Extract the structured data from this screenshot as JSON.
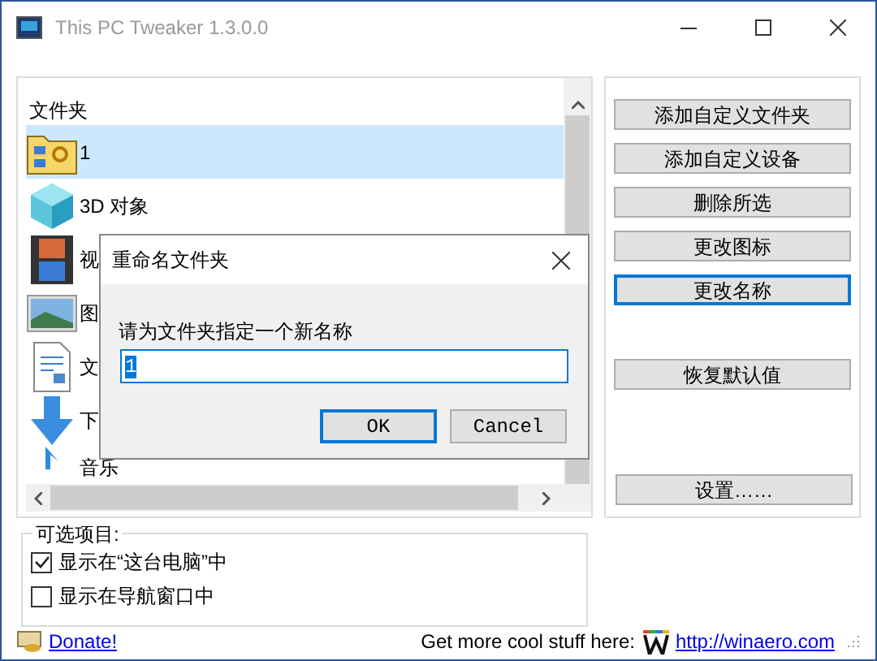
{
  "window": {
    "title": "This PC Tweaker 1.3.0.0"
  },
  "folders": {
    "header": "文件夹",
    "items": [
      {
        "label": "1",
        "kind": "custom",
        "selected": true
      },
      {
        "label": "3D 对象",
        "kind": "cube",
        "selected": false
      },
      {
        "label": "视",
        "kind": "film",
        "selected": false
      },
      {
        "label": "图",
        "kind": "picture",
        "selected": false
      },
      {
        "label": "文",
        "kind": "document",
        "selected": false
      },
      {
        "label": "下",
        "kind": "download",
        "selected": false
      },
      {
        "label": "音乐",
        "kind": "music",
        "selected": false
      }
    ]
  },
  "actions": [
    {
      "label": "添加自定义文件夹",
      "focused": false
    },
    {
      "label": "添加自定义设备",
      "focused": false
    },
    {
      "label": "删除所选",
      "focused": false
    },
    {
      "label": "更改图标",
      "focused": false
    },
    {
      "label": "更改名称",
      "focused": true
    },
    {
      "label": "恢复默认值",
      "focused": false
    }
  ],
  "settings_button": "设置……",
  "options": {
    "title": "可选项目:",
    "items": [
      {
        "label": "显示在“这台电脑”中",
        "checked": true
      },
      {
        "label": "显示在导航窗口中",
        "checked": false
      }
    ]
  },
  "footer": {
    "donate": "Donate!",
    "promo": "Get more cool stuff here:",
    "link": "http://winaero.com"
  },
  "dialog": {
    "title": "重命名文件夹",
    "prompt": "请为文件夹指定一个新名称",
    "value": "1",
    "buttons": [
      {
        "label": "OK",
        "default": true
      },
      {
        "label": "Cancel",
        "default": false
      }
    ]
  }
}
